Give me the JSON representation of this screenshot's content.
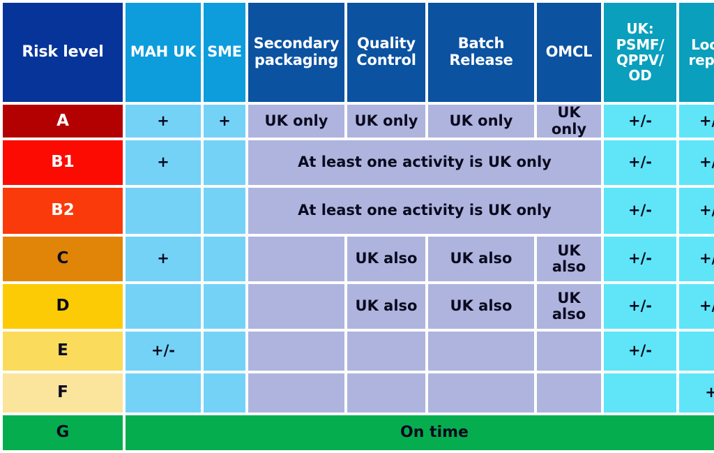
{
  "table": {
    "columns": [
      {
        "id": "risk-level",
        "label": "Risk level",
        "header_style": "navy"
      },
      {
        "id": "mah-uk",
        "label": "MAH UK",
        "header_style": "blue"
      },
      {
        "id": "sme",
        "label": "SME",
        "header_style": "blue"
      },
      {
        "id": "secondary-packaging",
        "label": "Secondary packaging",
        "header_style": "midblue"
      },
      {
        "id": "quality-control",
        "label": "Quality Control",
        "header_style": "midblue"
      },
      {
        "id": "batch-release",
        "label": "Batch Release",
        "header_style": "midblue"
      },
      {
        "id": "omcl",
        "label": "OMCL",
        "header_style": "midblue"
      },
      {
        "id": "uk-psmf-qppv-od",
        "label": "UK: PSMF/ QPPV/ OD",
        "header_style": "teal"
      },
      {
        "id": "local-rep",
        "label": "Local rep.**",
        "header_style": "teal"
      }
    ],
    "header_lines": {
      "risk_level": "Risk level",
      "mah_uk": "MAH UK",
      "sme": "SME",
      "secondary_packaging_l1": "Secondary",
      "secondary_packaging_l2": "packaging",
      "quality_control_l1": "Quality",
      "quality_control_l2": "Control",
      "batch_release_l1": "Batch",
      "batch_release_l2": "Release",
      "omcl": "OMCL",
      "psmf_l1": "UK:",
      "psmf_l2": "PSMF/",
      "psmf_l3": "QPPV/",
      "psmf_l4": "OD",
      "local_rep_l1": "Local",
      "local_rep_l2": "rep.**"
    },
    "rows": [
      {
        "level": "A",
        "mah_uk": "+",
        "sme": "+",
        "secondary_packaging": "UK only",
        "quality_control": "UK only",
        "batch_release": "UK only",
        "omcl": "UK only",
        "psmf": "+/-",
        "local_rep": "+/-"
      },
      {
        "level": "B1",
        "mah_uk": "+",
        "sme": "",
        "merged_activities": "At least one activity is UK only",
        "psmf": "+/-",
        "local_rep": "+/-"
      },
      {
        "level": "B2",
        "mah_uk": "",
        "sme": "",
        "merged_activities": "At least one activity is UK only",
        "psmf": "+/-",
        "local_rep": "+/-"
      },
      {
        "level": "C",
        "mah_uk": "+",
        "sme": "",
        "secondary_packaging": "",
        "quality_control": "UK also",
        "batch_release": "UK also",
        "omcl": "UK also",
        "psmf": "+/-",
        "local_rep": "+/-"
      },
      {
        "level": "D",
        "mah_uk": "",
        "sme": "",
        "secondary_packaging": "",
        "quality_control": "UK also",
        "batch_release": "UK also",
        "omcl": "UK also",
        "psmf": "+/-",
        "local_rep": "+/-"
      },
      {
        "level": "E",
        "mah_uk": "+/-",
        "sme": "",
        "secondary_packaging": "",
        "quality_control": "",
        "batch_release": "",
        "omcl": "",
        "psmf": "+/-",
        "local_rep": ""
      },
      {
        "level": "F",
        "mah_uk": "",
        "sme": "",
        "secondary_packaging": "",
        "quality_control": "",
        "batch_release": "",
        "omcl": "",
        "psmf": "",
        "local_rep": "+"
      },
      {
        "level": "G",
        "merged_all": "On time"
      }
    ]
  },
  "colors": {
    "header_navy": "#063499",
    "header_blue": "#0d9ddd",
    "header_midblue": "#0b52a0",
    "header_teal": "#0a9fbc",
    "cell_light_blue": "#74d2f7",
    "cell_purple": "#aeb4de",
    "cell_cyan": "#5fe5f7",
    "level_a": "#b30000",
    "level_b1": "#fc0b02",
    "level_b2": "#fa3a0a",
    "level_c": "#e08508",
    "level_d": "#fdcb06",
    "level_e": "#fbdb5c",
    "level_f": "#fbe49c",
    "level_g": "#06ad4e"
  }
}
